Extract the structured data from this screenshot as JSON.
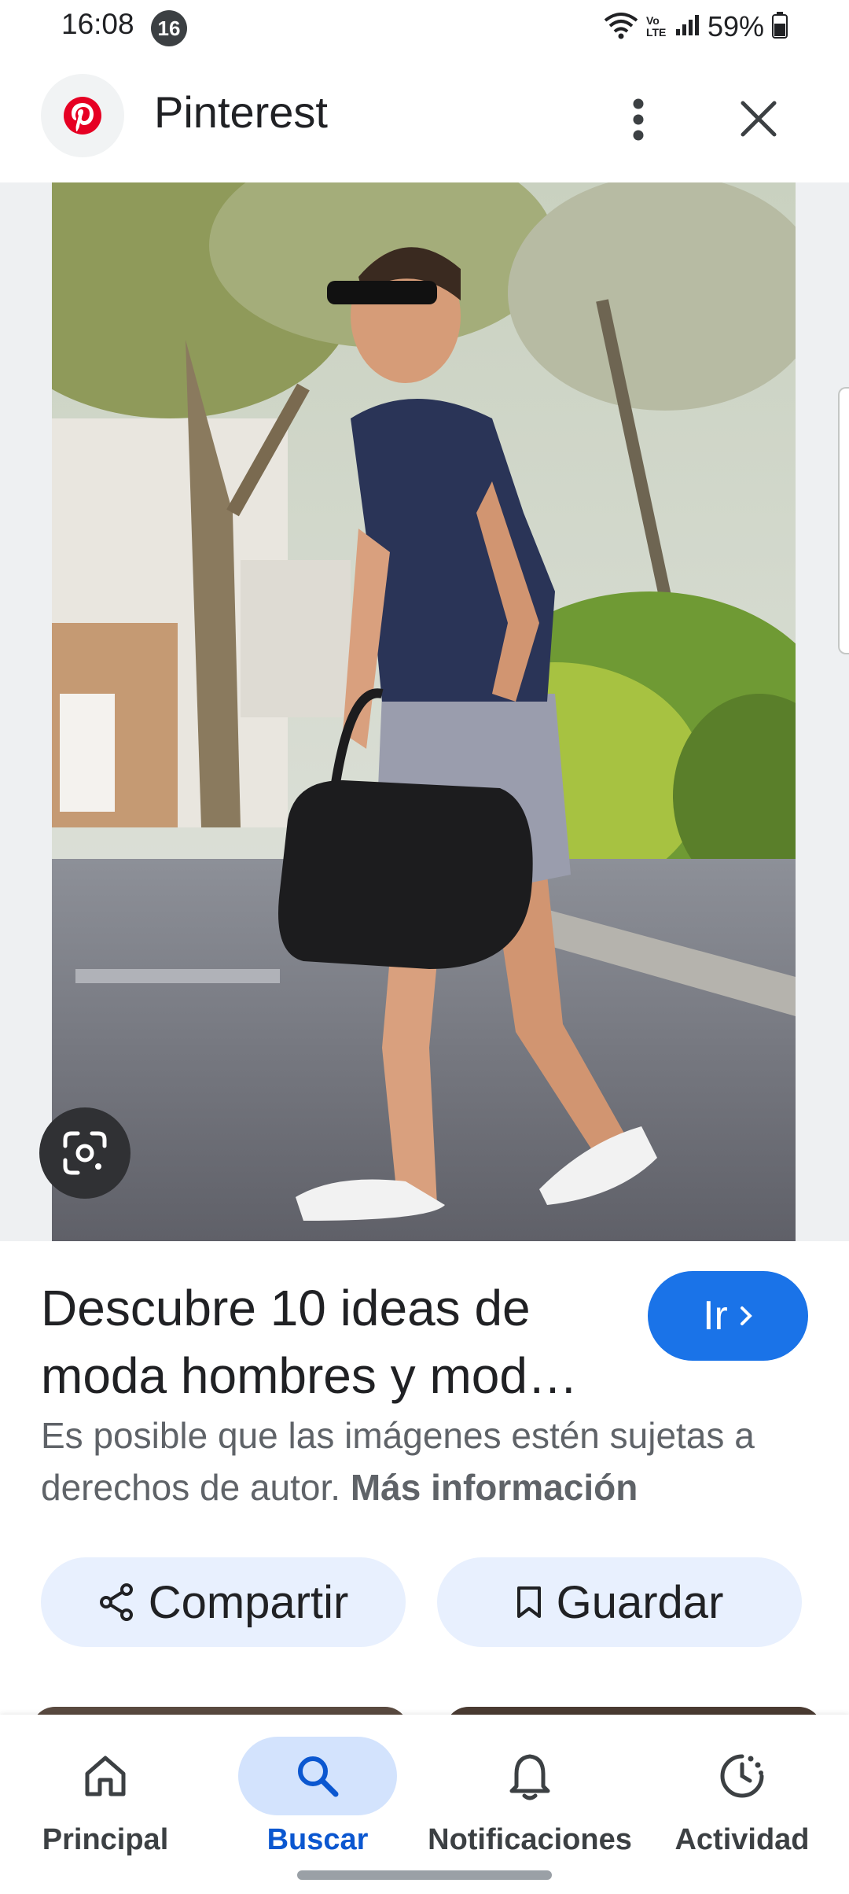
{
  "status_bar": {
    "time": "16:08",
    "notification_count": "16",
    "network_label": "Vo LTE",
    "battery": "59%"
  },
  "header": {
    "site_name": "Pinterest",
    "brand_color": "#e60023",
    "more_icon": "more-vert-icon",
    "close_icon": "close-icon"
  },
  "image": {
    "lens_icon": "google-lens-icon"
  },
  "result": {
    "title": "Descubre 10 ideas de moda hombres y mod…",
    "go_label": "Ir",
    "go_color": "#1a73e8",
    "copyright_text": "Es posible que las imágenes estén sujetas a derechos de autor.",
    "more_info": "Más información"
  },
  "actions": {
    "share_label": "Compartir",
    "save_label": "Guardar"
  },
  "bottom_nav": {
    "items": [
      {
        "label": "Principal",
        "icon": "home-icon",
        "active": false
      },
      {
        "label": "Buscar",
        "icon": "search-icon",
        "active": true
      },
      {
        "label": "Notificaciones",
        "icon": "bell-icon",
        "active": false
      },
      {
        "label": "Actividad",
        "icon": "activity-icon",
        "active": false
      }
    ],
    "active_color": "#0b57d0"
  }
}
